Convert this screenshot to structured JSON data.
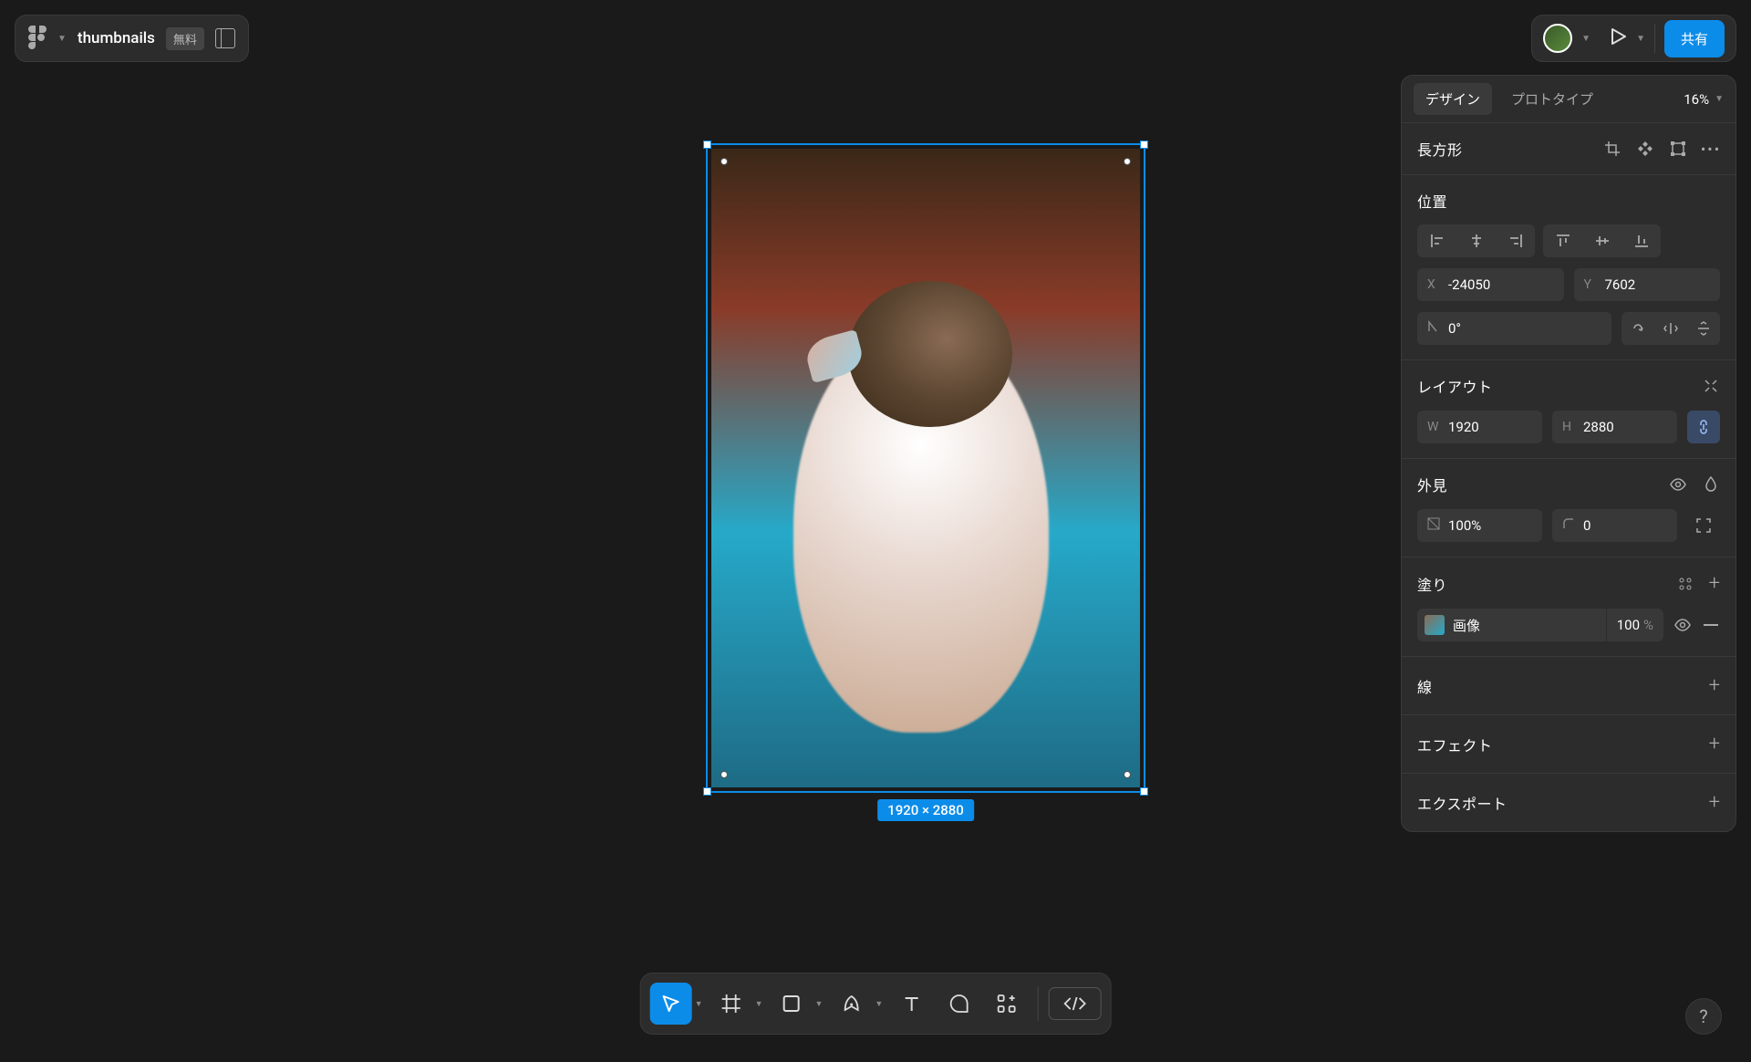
{
  "topbar": {
    "filename": "thumbnails",
    "badge": "無料"
  },
  "share_label": "共有",
  "tabs": {
    "design": "デザイン",
    "prototype": "プロトタイプ",
    "zoom": "16%"
  },
  "selection_badge": "1920 × 2880",
  "panels": {
    "rectangle": {
      "title": "長方形"
    },
    "position": {
      "title": "位置",
      "x_label": "X",
      "x": "-24050",
      "y_label": "Y",
      "y": "7602",
      "angle_prefix": "⌐",
      "angle": "0°"
    },
    "layout": {
      "title": "レイアウト",
      "w_label": "W",
      "w": "1920",
      "h_label": "H",
      "h": "2880"
    },
    "appearance": {
      "title": "外見",
      "opacity": "100%",
      "corner_label": "⌐",
      "corner": "0"
    },
    "fill": {
      "title": "塗り",
      "type_label": "画像",
      "opacity": "100",
      "opacity_unit": "%"
    },
    "stroke": {
      "title": "線"
    },
    "effect": {
      "title": "エフェクト"
    },
    "export": {
      "title": "エクスポート"
    }
  }
}
